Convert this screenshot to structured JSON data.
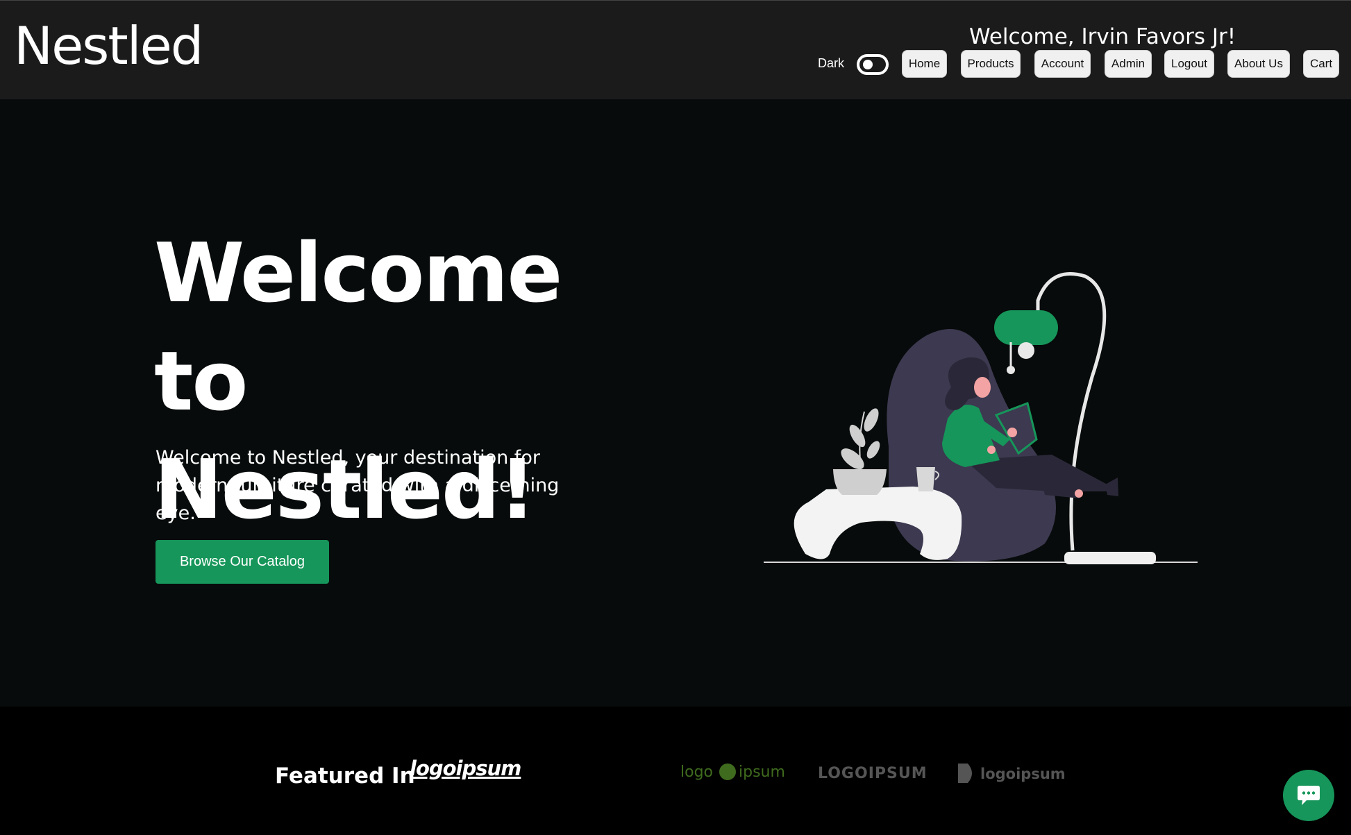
{
  "header": {
    "brand": "Nestled",
    "welcome": "Welcome, Irvin Favors Jr!",
    "theme_label": "Dark",
    "theme_dark": true,
    "nav": {
      "home": "Home",
      "products": "Products",
      "account": "Account",
      "admin": "Admin",
      "logout": "Logout",
      "about": "About Us",
      "cart": "Cart"
    }
  },
  "hero": {
    "title_line1": "Welcome",
    "title_line2": "to Nestled!",
    "text": "Welcome to Nestled, your destination for modern furniture curated with a discerning eye.",
    "cta": "Browse Our Catalog"
  },
  "featured": {
    "label": "Featured In",
    "logos": [
      "logoipsum",
      "logo ipsum",
      "LOGOIPSUM",
      "logoipsum"
    ]
  },
  "colors": {
    "accent": "#16965a",
    "header_bg": "#1b1b1b",
    "hero_bg": "#070b0b"
  },
  "icons": {
    "chat": "chat-bubble-icon",
    "theme_toggle": "toggle-switch-icon"
  }
}
